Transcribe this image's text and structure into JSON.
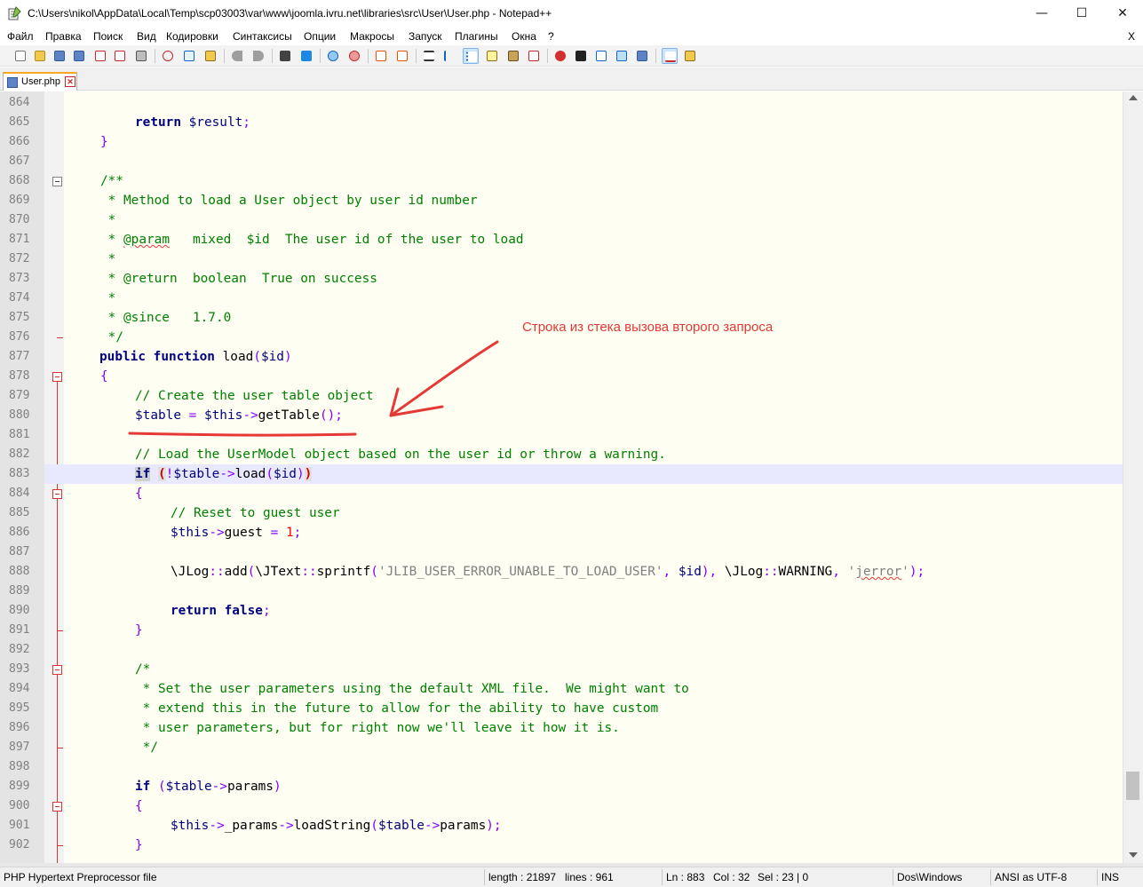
{
  "window": {
    "title": "C:\\Users\\nikol\\AppData\\Local\\Temp\\scp03003\\var\\www\\joomla.ivru.net\\libraries\\src\\User\\User.php - Notepad++",
    "minimize": "—",
    "maximize": "☐",
    "close": "✕"
  },
  "menu": {
    "items": [
      "Файл",
      "Правка",
      "Поиск",
      "Вид",
      "Кодировки",
      "Синтаксисы",
      "Опции",
      "Макросы",
      "Запуск",
      "Плагины",
      "Окна",
      "?"
    ],
    "close": "X"
  },
  "toolbar": {
    "icons": [
      "new-file-icon",
      "open-file-icon",
      "save-icon",
      "save-all-icon",
      "close-icon",
      "close-all-icon",
      "print-icon",
      "cut-icon",
      "copy-icon",
      "paste-icon",
      "undo-icon",
      "redo-icon",
      "find-icon",
      "replace-icon",
      "zoom-in-icon",
      "zoom-out-icon",
      "sync-vertical-icon",
      "sync-horizontal-icon",
      "word-wrap-icon",
      "show-all-chars-icon",
      "indent-guide-icon",
      "user-defined-language-icon",
      "document-map-icon",
      "function-list-icon",
      "record-macro-icon",
      "stop-record-icon",
      "play-macro-icon",
      "run-macro-multiple-icon",
      "save-macro-icon",
      "spell-check-icon",
      "spell-check-settings-icon"
    ]
  },
  "tab": {
    "label": "User.php",
    "close": "✕"
  },
  "editor": {
    "current_line": "883",
    "lines": [
      {
        "n": "864"
      },
      {
        "n": "865"
      },
      {
        "n": "866"
      },
      {
        "n": "867"
      },
      {
        "n": "868"
      },
      {
        "n": "869"
      },
      {
        "n": "870"
      },
      {
        "n": "871"
      },
      {
        "n": "872"
      },
      {
        "n": "873"
      },
      {
        "n": "874"
      },
      {
        "n": "875"
      },
      {
        "n": "876"
      },
      {
        "n": "877"
      },
      {
        "n": "878"
      },
      {
        "n": "879"
      },
      {
        "n": "880"
      },
      {
        "n": "881"
      },
      {
        "n": "882"
      },
      {
        "n": "883"
      },
      {
        "n": "884"
      },
      {
        "n": "885"
      },
      {
        "n": "886"
      },
      {
        "n": "887"
      },
      {
        "n": "888"
      },
      {
        "n": "889"
      },
      {
        "n": "890"
      },
      {
        "n": "891"
      },
      {
        "n": "892"
      },
      {
        "n": "893"
      },
      {
        "n": "894"
      },
      {
        "n": "895"
      },
      {
        "n": "896"
      },
      {
        "n": "897"
      },
      {
        "n": "898"
      },
      {
        "n": "899"
      },
      {
        "n": "900"
      },
      {
        "n": "901"
      },
      {
        "n": "902"
      }
    ],
    "code": {
      "l865_return": "return",
      "l865_var": " $result",
      "l865_semi": ";",
      "l866": "}",
      "l868": "/**",
      "l869": " * Method to load a User object by user id number",
      "l870": " *",
      "l871_a": " * ",
      "l871_param": "@param",
      "l871_b": "   mixed  $id  The user id of the user to load",
      "l872": " *",
      "l873": " * @return  boolean  True on success",
      "l874": " *",
      "l875": " * @since   1.7.0",
      "l876": " */",
      "l877_public": "public",
      "l877_function": "function",
      "l877_name": " load",
      "l877_open": "(",
      "l877_var": "$id",
      "l877_close": ")",
      "l878": "{",
      "l879": "// Create the user table object",
      "l880_var": "$table",
      "l880_eq": " = ",
      "l880_this": "$this",
      "l880_arrow": "->",
      "l880_fn": "getTable",
      "l880_paren": "();",
      "l882": "// Load the UserModel object based on the user id or throw a warning.",
      "l883_if": "if",
      "l883_space": " ",
      "l883_open": "(",
      "l883_not": "!",
      "l883_var": "$table",
      "l883_arrow": "->",
      "l883_fn": "load",
      "l883_p1": "(",
      "l883_id": "$id",
      "l883_p2": ")",
      "l883_close": ")",
      "l884": "{",
      "l885": "// Reset to guest user",
      "l886_this": "$this",
      "l886_arrow": "->",
      "l886_prop": "guest",
      "l886_eq": " = ",
      "l886_num": "1",
      "l886_semi": ";",
      "l888_a": "\\JLog",
      "l888_b": "::",
      "l888_c": "add",
      "l888_d": "(",
      "l888_e": "\\JText",
      "l888_f": "::",
      "l888_g": "sprintf",
      "l888_h": "(",
      "l888_i": "'JLIB_USER_ERROR_UNABLE_TO_LOAD_USER'",
      "l888_j": ", ",
      "l888_k": "$id",
      "l888_l": "), ",
      "l888_m": "\\JLog",
      "l888_n": "::",
      "l888_o": "WARNING",
      "l888_p": ", ",
      "l888_q1": "'",
      "l888_q": "jerror",
      "l888_q2": "'",
      "l888_r": ");",
      "l890_return": "return",
      "l890_false": " false",
      "l890_semi": ";",
      "l891": "}",
      "l893": "/*",
      "l894": " * Set the user parameters using the default XML file.  We might want to",
      "l895": " * extend this in the future to allow for the ability to have custom",
      "l896": " * user parameters, but for right now we'll leave it how it is.",
      "l897": " */",
      "l899_if": "if",
      "l899_open": " (",
      "l899_var": "$table",
      "l899_arrow": "->",
      "l899_prop": "params",
      "l899_close": ")",
      "l900": "{",
      "l901_this": "$this",
      "l901_arrow": "->",
      "l901_prop": "_params",
      "l901_arrow2": "->",
      "l901_fn": "loadString",
      "l901_open": "(",
      "l901_var": "$table",
      "l901_arrow3": "->",
      "l901_prop2": "params",
      "l901_close": ");",
      "l902": "}"
    }
  },
  "annotation": {
    "text": "Строка из стека вызова второго запроса",
    "color": "#e53935"
  },
  "statusbar": {
    "file_type": "PHP Hypertext Preprocessor file",
    "length": "length : 21897",
    "lines": "lines : 961",
    "ln": "Ln : 883",
    "col": "Col : 32",
    "sel": "Sel : 23 | 0",
    "eol": "Dos\\Windows",
    "encoding": "ANSI as UTF-8",
    "mode": "INS"
  },
  "colors": {
    "keyword": "#00007f",
    "comment": "#008000",
    "operator": "#8000ff",
    "number": "#ff0000",
    "string": "#808080",
    "editor_bg": "#fefef3",
    "current_line_bg": "#e8e8ff"
  }
}
